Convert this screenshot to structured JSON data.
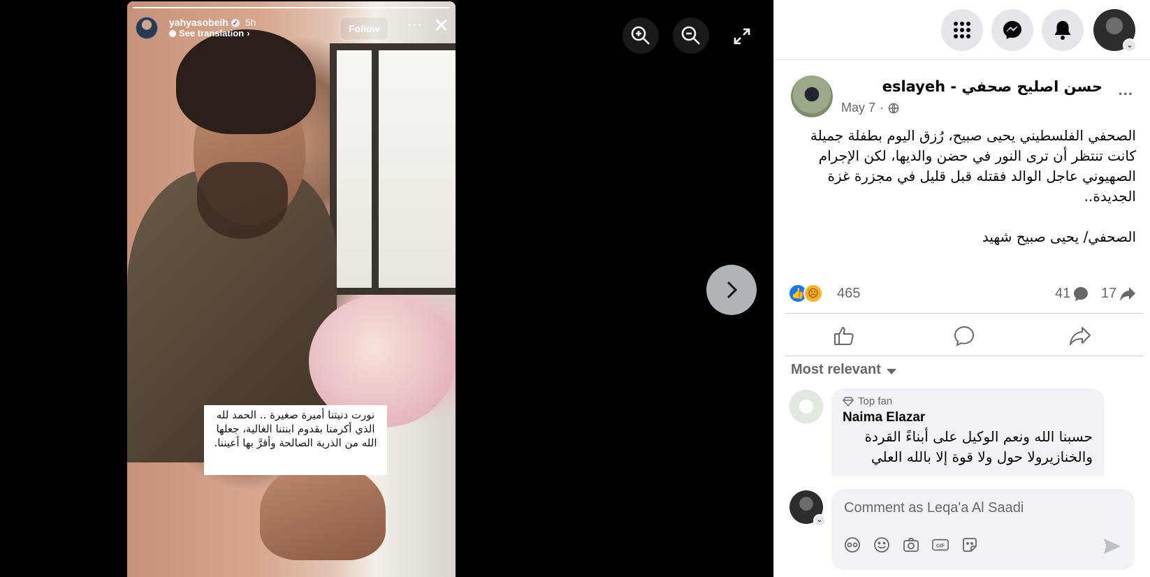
{
  "story": {
    "username": "yahyasobeih",
    "verified_icon": "verified-badge-icon",
    "time": "5h",
    "see_translation": "See translation",
    "follow_label": "Follow",
    "more_label": "···",
    "progress": 1.0,
    "caption": "نورت دنيتنا أميرة صغيرة .. الحمد لله الذي أكرمنا بقدوم ابنتنا الغالية، جعلها الله من الذرية الصالحة وأقرَّ بها أعيننا."
  },
  "viewer_tools": {
    "zoom_in_icon": "zoom-in-icon",
    "zoom_out_icon": "zoom-out-icon",
    "expand_icon": "fullscreen-icon",
    "next_icon": "chevron-right-icon"
  },
  "topbar": {
    "icons": [
      "apps-grid-icon",
      "messenger-icon",
      "notifications-bell-icon",
      "profile-avatar"
    ]
  },
  "post": {
    "page_name": "حسن اصليح صحفي - eslayeh",
    "date": "May 7",
    "privacy_icon": "globe-icon",
    "more_label": "...",
    "paragraphs": [
      "الصحفي الفلسطيني يحيى صبيح، رُزق اليوم بطفلة جميلة كانت تنتظر أن ترى النور في حضن والديها، لكن الإجرام الصهيوني عاجل الوالد فقتله قبل قليل في مجزرة غزة الجديدة..",
      "الصحفي/ يحيى صبيح شهيد"
    ],
    "reactions_count": "465",
    "comments_count": "41",
    "shares_count": "17"
  },
  "comments": {
    "sort_label": "Most relevant",
    "items": [
      {
        "badge": "Top fan",
        "author": "Naima Elazar",
        "text": "حسبنا الله ونعم الوكيل على أبناءً القردة والخنازيرولا حول ولا قوة إلا بالله العلي"
      }
    ]
  },
  "composer": {
    "placeholder": "Comment as Leqa'a Al Saadi",
    "tools": [
      "avatar-sticker-icon",
      "emoji-icon",
      "camera-icon",
      "gif-icon",
      "sticker-icon"
    ]
  },
  "colors": {
    "accent": "#1877f2",
    "secondary_text": "#65676b",
    "bubble_bg": "#f0f2f5"
  }
}
